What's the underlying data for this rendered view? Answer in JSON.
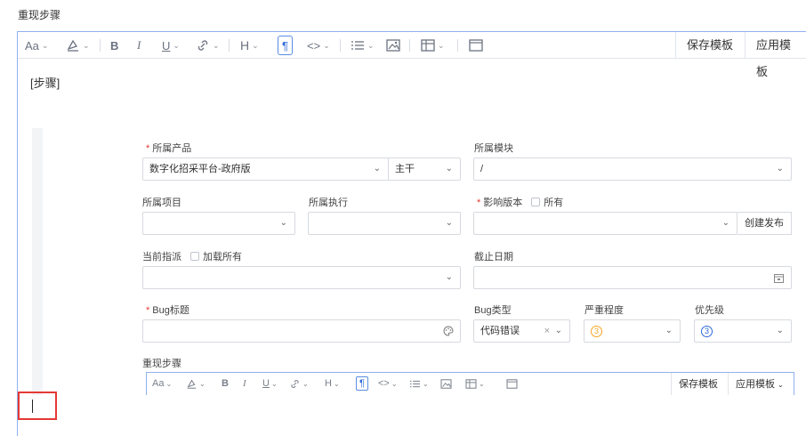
{
  "page": {
    "label": "重现步骤"
  },
  "toolbar": {
    "font_size": "Aa",
    "bold": "B",
    "italic": "I",
    "underline": "U",
    "heading": "H",
    "paragraph": "¶",
    "code": "<>",
    "save_template": "保存模板",
    "apply_template": "应用模板"
  },
  "editor": {
    "content": "[步骤]"
  },
  "form": {
    "product": {
      "label": "所属产品",
      "value": "数字化招采平台-政府版",
      "branch": "主干"
    },
    "module": {
      "label": "所属模块",
      "value": "/"
    },
    "project": {
      "label": "所属项目",
      "value": ""
    },
    "execution": {
      "label": "所属执行",
      "value": ""
    },
    "build": {
      "label": "影响版本",
      "all_label": "所有",
      "create_button": "创建发布"
    },
    "assignee": {
      "label": "当前指派",
      "load_all_label": "加载所有"
    },
    "deadline": {
      "label": "截止日期"
    },
    "title": {
      "label": "Bug标题",
      "value": ""
    },
    "type": {
      "label": "Bug类型",
      "value": "代码错误"
    },
    "severity": {
      "label": "严重程度",
      "value": "3"
    },
    "priority": {
      "label": "优先级",
      "value": "3"
    },
    "steps": {
      "label": "重现步骤"
    }
  },
  "sub_toolbar": {
    "font_size": "Aa",
    "bold": "B",
    "italic": "I",
    "underline": "U",
    "heading": "H",
    "paragraph": "¶",
    "code": "<>",
    "save_template": "保存模板",
    "apply_template": "应用模板"
  },
  "colors": {
    "accent": "#2f6bd9",
    "required": "#e53935",
    "highlight": "#e53935",
    "severity": "#f5a623"
  }
}
